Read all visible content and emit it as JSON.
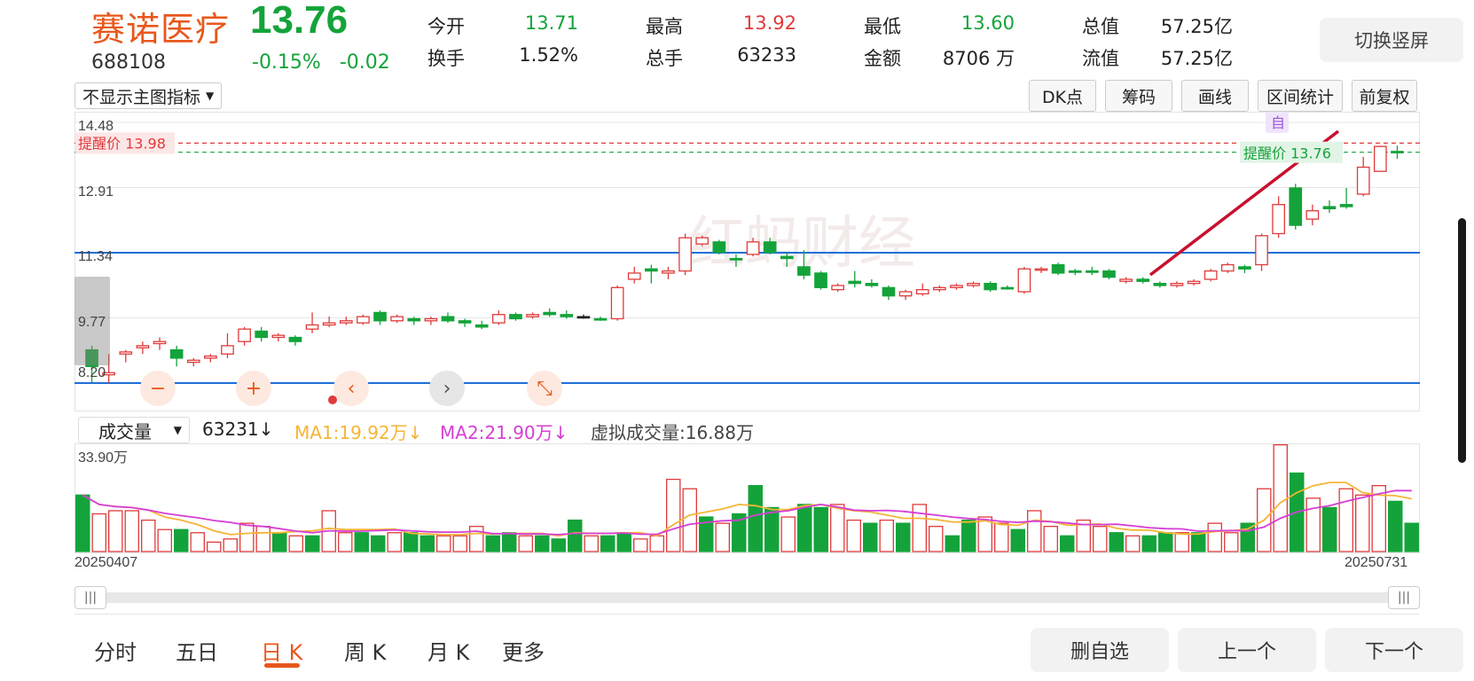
{
  "quote": {
    "name": "赛诺医疗",
    "code": "688108",
    "price": "13.76",
    "change_pct": "-0.15%",
    "change_amt": "-0.02",
    "fields": [
      {
        "label": "今开",
        "value": "13.71",
        "color": "green"
      },
      {
        "label": "换手",
        "value": "1.52%",
        "color": "plain"
      },
      {
        "label": "最高",
        "value": "13.92",
        "color": "red"
      },
      {
        "label": "总手",
        "value": "63233",
        "color": "plain"
      },
      {
        "label": "最低",
        "value": "13.60",
        "color": "green"
      },
      {
        "label": "金额",
        "value": "8706 万",
        "color": "plain"
      },
      {
        "label": "总值",
        "value": "57.25亿",
        "color": "plain"
      },
      {
        "label": "流值",
        "value": "57.25亿",
        "color": "plain"
      }
    ]
  },
  "header": {
    "switch_label": "切换竖屏"
  },
  "toolbar": {
    "indicator_select": "不显示主图指标",
    "buttons": [
      "DK点",
      "筹码",
      "画线",
      "区间统计",
      "前复权"
    ]
  },
  "chart": {
    "y_ticks": [
      "14.48",
      "12.91",
      "11.34",
      "9.77",
      "8.20"
    ],
    "y_values": [
      14.48,
      12.91,
      11.34,
      9.77,
      8.2
    ],
    "alert_high": "提醒价 13.98",
    "alert_high_value": 13.98,
    "alert_low": "提醒价 13.76",
    "alert_low_value": 13.76,
    "self_tag": "自",
    "watermark": "红蚂财经",
    "blue_lines": [
      11.34,
      8.2
    ],
    "controls": [
      "−",
      "+",
      "‹",
      "›",
      "⤡"
    ]
  },
  "chart_data": {
    "type": "candlestick",
    "ylim": [
      8.2,
      14.48
    ],
    "date_start": "20250407",
    "date_end": "20250731",
    "candles": [
      [
        9.0,
        8.6,
        9.1,
        8.2,
        "down"
      ],
      [
        8.45,
        8.4,
        8.9,
        8.2,
        "up"
      ],
      [
        8.9,
        8.95,
        9.0,
        8.7,
        "up"
      ],
      [
        9.1,
        9.05,
        9.2,
        8.9,
        "up"
      ],
      [
        9.2,
        9.15,
        9.3,
        9.0,
        "up"
      ],
      [
        9.0,
        8.8,
        9.1,
        8.6,
        "down"
      ],
      [
        8.7,
        8.75,
        8.8,
        8.6,
        "up"
      ],
      [
        8.8,
        8.85,
        8.9,
        8.7,
        "up"
      ],
      [
        8.9,
        9.1,
        9.4,
        8.8,
        "up"
      ],
      [
        9.2,
        9.5,
        9.55,
        9.1,
        "up"
      ],
      [
        9.45,
        9.3,
        9.55,
        9.2,
        "down"
      ],
      [
        9.3,
        9.35,
        9.4,
        9.2,
        "up"
      ],
      [
        9.3,
        9.2,
        9.35,
        9.1,
        "down"
      ],
      [
        9.5,
        9.6,
        9.9,
        9.4,
        "up"
      ],
      [
        9.6,
        9.65,
        9.8,
        9.55,
        "up"
      ],
      [
        9.65,
        9.7,
        9.8,
        9.6,
        "up"
      ],
      [
        9.65,
        9.8,
        9.85,
        9.6,
        "up"
      ],
      [
        9.9,
        9.7,
        9.95,
        9.6,
        "down"
      ],
      [
        9.7,
        9.8,
        9.85,
        9.65,
        "up"
      ],
      [
        9.75,
        9.7,
        9.8,
        9.6,
        "down"
      ],
      [
        9.7,
        9.75,
        9.8,
        9.6,
        "up"
      ],
      [
        9.8,
        9.7,
        9.9,
        9.65,
        "down"
      ],
      [
        9.7,
        9.65,
        9.75,
        9.55,
        "down"
      ],
      [
        9.6,
        9.55,
        9.7,
        9.5,
        "down"
      ],
      [
        9.65,
        9.85,
        9.95,
        9.6,
        "up"
      ],
      [
        9.85,
        9.75,
        9.9,
        9.7,
        "down"
      ],
      [
        9.8,
        9.85,
        9.9,
        9.75,
        "up"
      ],
      [
        9.9,
        9.85,
        10.0,
        9.8,
        "down"
      ],
      [
        9.85,
        9.8,
        9.95,
        9.75,
        "down"
      ],
      [
        9.8,
        9.8,
        9.85,
        9.75,
        "flat"
      ],
      [
        9.75,
        9.75,
        9.8,
        9.7,
        "down"
      ],
      [
        9.75,
        10.5,
        10.55,
        9.7,
        "up"
      ],
      [
        10.7,
        10.85,
        11.0,
        10.6,
        "up"
      ],
      [
        10.95,
        10.9,
        11.05,
        10.6,
        "down"
      ],
      [
        10.85,
        10.9,
        11.0,
        10.7,
        "up"
      ],
      [
        10.9,
        11.7,
        11.8,
        10.8,
        "up"
      ],
      [
        11.55,
        11.7,
        11.75,
        11.5,
        "up"
      ],
      [
        11.6,
        11.35,
        11.65,
        11.3,
        "down"
      ],
      [
        11.2,
        11.2,
        11.3,
        11.0,
        "down"
      ],
      [
        11.3,
        11.6,
        11.7,
        11.25,
        "up"
      ],
      [
        11.6,
        11.35,
        11.7,
        11.3,
        "down"
      ],
      [
        11.25,
        11.2,
        11.35,
        11.0,
        "down"
      ],
      [
        11.0,
        10.8,
        11.4,
        10.7,
        "down"
      ],
      [
        10.85,
        10.5,
        10.9,
        10.45,
        "down"
      ],
      [
        10.45,
        10.55,
        10.6,
        10.4,
        "up"
      ],
      [
        10.65,
        10.6,
        10.9,
        10.5,
        "down"
      ],
      [
        10.6,
        10.55,
        10.7,
        10.5,
        "down"
      ],
      [
        10.5,
        10.3,
        10.55,
        10.2,
        "down"
      ],
      [
        10.3,
        10.4,
        10.45,
        10.2,
        "up"
      ],
      [
        10.35,
        10.45,
        10.6,
        10.3,
        "up"
      ],
      [
        10.45,
        10.5,
        10.55,
        10.4,
        "up"
      ],
      [
        10.5,
        10.55,
        10.6,
        10.45,
        "up"
      ],
      [
        10.55,
        10.6,
        10.65,
        10.5,
        "up"
      ],
      [
        10.6,
        10.45,
        10.65,
        10.4,
        "down"
      ],
      [
        10.5,
        10.5,
        10.55,
        10.45,
        "down"
      ],
      [
        10.4,
        10.95,
        11.0,
        10.35,
        "up"
      ],
      [
        10.95,
        10.95,
        11.0,
        10.85,
        "up"
      ],
      [
        11.05,
        10.85,
        11.1,
        10.8,
        "down"
      ],
      [
        10.9,
        10.9,
        10.95,
        10.8,
        "down"
      ],
      [
        10.9,
        10.9,
        11.0,
        10.8,
        "down"
      ],
      [
        10.9,
        10.75,
        10.95,
        10.7,
        "down"
      ],
      [
        10.65,
        10.7,
        10.75,
        10.6,
        "up"
      ],
      [
        10.7,
        10.65,
        10.75,
        10.6,
        "down"
      ],
      [
        10.6,
        10.55,
        10.65,
        10.5,
        "down"
      ],
      [
        10.55,
        10.6,
        10.65,
        10.5,
        "up"
      ],
      [
        10.6,
        10.65,
        10.7,
        10.55,
        "up"
      ],
      [
        10.7,
        10.9,
        10.95,
        10.65,
        "up"
      ],
      [
        10.9,
        11.05,
        11.1,
        10.85,
        "up"
      ],
      [
        10.95,
        11.0,
        11.05,
        10.85,
        "down"
      ],
      [
        11.05,
        11.75,
        11.8,
        10.9,
        "up"
      ],
      [
        11.8,
        12.5,
        12.7,
        11.7,
        "up"
      ],
      [
        12.9,
        12.0,
        13.0,
        11.9,
        "down"
      ],
      [
        12.15,
        12.35,
        12.5,
        12.0,
        "up"
      ],
      [
        12.4,
        12.45,
        12.6,
        12.3,
        "down"
      ],
      [
        12.45,
        12.5,
        12.9,
        12.4,
        "down"
      ],
      [
        12.75,
        13.4,
        13.65,
        12.7,
        "up"
      ],
      [
        13.3,
        13.9,
        13.92,
        13.3,
        "up"
      ],
      [
        13.78,
        13.76,
        13.92,
        13.6,
        "down"
      ]
    ]
  },
  "volume": {
    "select_label": "成交量",
    "current": "63231",
    "ma1": "MA1:19.92万",
    "ma2": "MA2:21.90万",
    "virtual": "虚拟成交量:16.88万",
    "max_label": "33.90万",
    "max_value": 33.9,
    "date_start": "20250407",
    "date_end": "20250731",
    "arrow": "↓",
    "bars": [
      18,
      12,
      13,
      13,
      10,
      7,
      7,
      6,
      3,
      4,
      9,
      8,
      6,
      5,
      5,
      13,
      6,
      6,
      5,
      6,
      6,
      5,
      5,
      5,
      8,
      5,
      6,
      5,
      5,
      4,
      10,
      5,
      5,
      6,
      4,
      5,
      23,
      20,
      11,
      9,
      12,
      21,
      14,
      11,
      15,
      14,
      15,
      10,
      9,
      10,
      9,
      15,
      8,
      5,
      10,
      11,
      9,
      7,
      13,
      8,
      5,
      10,
      8,
      6,
      5,
      5,
      6,
      6,
      6,
      9,
      6,
      9,
      20,
      34,
      25,
      17,
      14,
      20,
      18,
      21,
      16,
      9
    ],
    "colors": [
      "d",
      "u",
      "u",
      "u",
      "u",
      "u",
      "d",
      "u",
      "u",
      "u",
      "u",
      "u",
      "d",
      "u",
      "d",
      "u",
      "u",
      "d",
      "d",
      "u",
      "d",
      "d",
      "u",
      "u",
      "u",
      "d",
      "d",
      "u",
      "d",
      "d",
      "d",
      "u",
      "d",
      "d",
      "u",
      "u",
      "u",
      "u",
      "d",
      "u",
      "d",
      "d",
      "d",
      "u",
      "d",
      "d",
      "u",
      "u",
      "d",
      "u",
      "d",
      "u",
      "u",
      "d",
      "d",
      "u",
      "u",
      "d",
      "u",
      "u",
      "d",
      "u",
      "u",
      "d",
      "u",
      "d",
      "d",
      "u",
      "d",
      "u",
      "u",
      "d",
      "u",
      "u",
      "d",
      "u",
      "d",
      "u",
      "u",
      "u",
      "d",
      "d"
    ]
  },
  "periods": {
    "tabs": [
      "分时",
      "五日",
      "日 K",
      "周 K",
      "月 K",
      "更多"
    ],
    "active": 2
  },
  "footer": {
    "delete_label": "删自选",
    "prev_label": "上一个",
    "next_label": "下一个"
  },
  "colors": {
    "up": "#e03a3a",
    "down": "#14a33a",
    "accent": "#e8581c",
    "blue_line": "#1e6fd9",
    "ma1": "#f5b536",
    "ma2": "#d63ed6",
    "trend": "#c8102e"
  }
}
